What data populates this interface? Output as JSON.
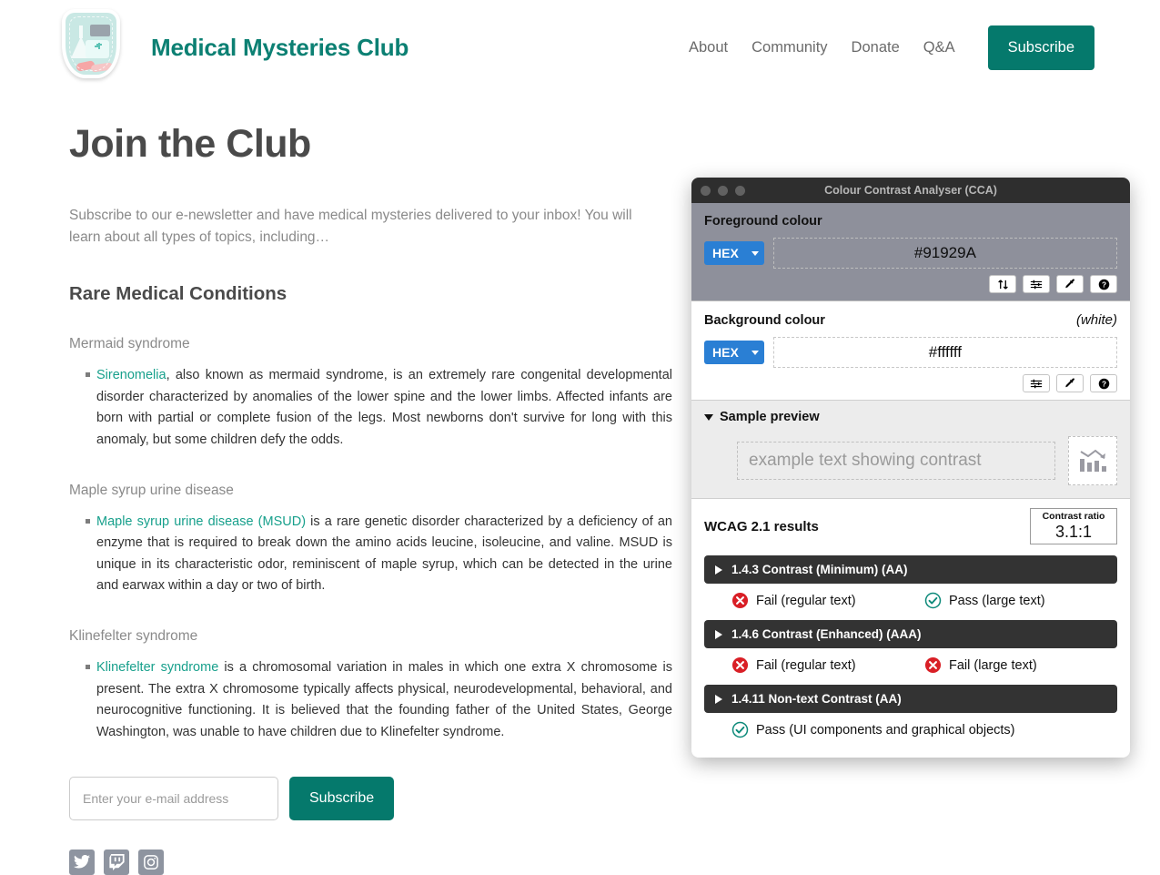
{
  "header": {
    "logo_name": "medical-mysteries-shield-logo",
    "brand": "Medical Mysteries Club",
    "nav": [
      {
        "label": "About"
      },
      {
        "label": "Community"
      },
      {
        "label": "Donate"
      },
      {
        "label": "Q&A"
      }
    ],
    "subscribe_button": "Subscribe",
    "accent_color": "#05796c",
    "brand_color": "#0c8073"
  },
  "main": {
    "page_title": "Join the Club",
    "intro": "Subscribe to our e-newsletter and have medical mysteries delivered to your inbox! You will learn about all types of topics, including…",
    "section_title": "Rare Medical Conditions",
    "conditions": [
      {
        "heading": "Mermaid syndrome",
        "link": "Sirenomelia",
        "body": ", also known as mermaid syndrome, is an extremely rare congenital developmental disorder characterized by anomalies of the lower spine and the lower limbs. Affected infants are born with partial or complete fusion of the legs. Most newborns don't survive for long with this anomaly, but some children defy the odds."
      },
      {
        "heading": "Maple syrup urine disease",
        "link": "Maple syrup urine disease (MSUD)",
        "body": " is a rare genetic disorder characterized by a deficiency of an enzyme that is required to break down the amino acids leucine, isoleucine, and valine. MSUD is unique in its characteristic odor, reminiscent of maple syrup, which can be detected in the urine and earwax within a day or two of birth."
      },
      {
        "heading": "Klinefelter syndrome",
        "link": "Klinefelter syndrome",
        "body": " is a chromosomal variation in males in which one extra X chromosome is present. The extra X chromosome typically affects physical, neurodevelopmental, behavioral, and neurocognitive functioning. It is believed that the founding father of the United States, George Washington, was unable to have children due to Klinefelter syndrome."
      }
    ],
    "signup": {
      "email_placeholder": "Enter your e-mail address",
      "email_value": "",
      "button": "Subscribe"
    },
    "socials": [
      {
        "name": "twitter-icon"
      },
      {
        "name": "twitch-icon"
      },
      {
        "name": "instagram-icon"
      }
    ],
    "link_color": "#18a08c"
  },
  "cca": {
    "window_title": "Colour Contrast Analyser (CCA)",
    "foreground": {
      "label": "Foreground colour",
      "format": "HEX",
      "value": "#91929A",
      "icons": [
        "swap-colours-icon",
        "sliders-icon",
        "eyedropper-icon",
        "help-icon"
      ]
    },
    "background": {
      "label": "Background colour",
      "note": "(white)",
      "format": "HEX",
      "value": "#ffffff",
      "icons": [
        "sliders-icon",
        "eyedropper-icon",
        "help-icon"
      ]
    },
    "preview": {
      "label": "Sample preview",
      "sample_text": "example text showing contrast",
      "chart_icon": "declining-bar-chart-icon"
    },
    "wcag": {
      "title": "WCAG 2.1 results",
      "ratio_label": "Contrast ratio",
      "ratio_value": "3.1:1",
      "criteria": [
        {
          "title": "1.4.3 Contrast (Minimum) (AA)",
          "results": [
            {
              "status": "fail",
              "label": "Fail (regular text)"
            },
            {
              "status": "pass",
              "label": "Pass (large text)"
            }
          ]
        },
        {
          "title": "1.4.6 Contrast (Enhanced) (AAA)",
          "results": [
            {
              "status": "fail",
              "label": "Fail (regular text)"
            },
            {
              "status": "fail",
              "label": "Fail (large text)"
            }
          ]
        },
        {
          "title": "1.4.11 Non-text Contrast (AA)",
          "results": [
            {
              "status": "pass",
              "label": "Pass (UI components and graphical objects)"
            }
          ]
        }
      ],
      "pass_color": "#0d8a7a",
      "fail_color": "#d91f26"
    }
  }
}
